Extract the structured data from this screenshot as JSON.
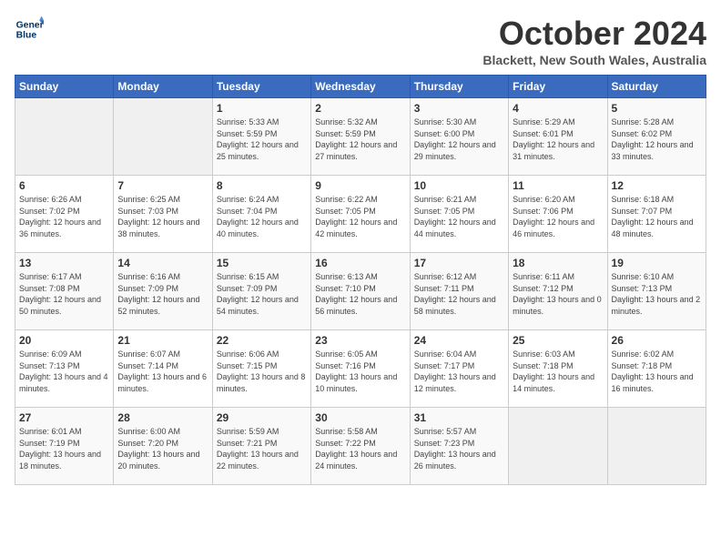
{
  "logo": {
    "line1": "General",
    "line2": "Blue"
  },
  "header": {
    "month": "October 2024",
    "location": "Blackett, New South Wales, Australia"
  },
  "weekdays": [
    "Sunday",
    "Monday",
    "Tuesday",
    "Wednesday",
    "Thursday",
    "Friday",
    "Saturday"
  ],
  "weeks": [
    [
      {
        "day": "",
        "empty": true
      },
      {
        "day": "",
        "empty": true
      },
      {
        "day": "1",
        "sunrise": "Sunrise: 5:33 AM",
        "sunset": "Sunset: 5:59 PM",
        "daylight": "Daylight: 12 hours and 25 minutes."
      },
      {
        "day": "2",
        "sunrise": "Sunrise: 5:32 AM",
        "sunset": "Sunset: 5:59 PM",
        "daylight": "Daylight: 12 hours and 27 minutes."
      },
      {
        "day": "3",
        "sunrise": "Sunrise: 5:30 AM",
        "sunset": "Sunset: 6:00 PM",
        "daylight": "Daylight: 12 hours and 29 minutes."
      },
      {
        "day": "4",
        "sunrise": "Sunrise: 5:29 AM",
        "sunset": "Sunset: 6:01 PM",
        "daylight": "Daylight: 12 hours and 31 minutes."
      },
      {
        "day": "5",
        "sunrise": "Sunrise: 5:28 AM",
        "sunset": "Sunset: 6:02 PM",
        "daylight": "Daylight: 12 hours and 33 minutes."
      }
    ],
    [
      {
        "day": "6",
        "sunrise": "Sunrise: 6:26 AM",
        "sunset": "Sunset: 7:02 PM",
        "daylight": "Daylight: 12 hours and 36 minutes."
      },
      {
        "day": "7",
        "sunrise": "Sunrise: 6:25 AM",
        "sunset": "Sunset: 7:03 PM",
        "daylight": "Daylight: 12 hours and 38 minutes."
      },
      {
        "day": "8",
        "sunrise": "Sunrise: 6:24 AM",
        "sunset": "Sunset: 7:04 PM",
        "daylight": "Daylight: 12 hours and 40 minutes."
      },
      {
        "day": "9",
        "sunrise": "Sunrise: 6:22 AM",
        "sunset": "Sunset: 7:05 PM",
        "daylight": "Daylight: 12 hours and 42 minutes."
      },
      {
        "day": "10",
        "sunrise": "Sunrise: 6:21 AM",
        "sunset": "Sunset: 7:05 PM",
        "daylight": "Daylight: 12 hours and 44 minutes."
      },
      {
        "day": "11",
        "sunrise": "Sunrise: 6:20 AM",
        "sunset": "Sunset: 7:06 PM",
        "daylight": "Daylight: 12 hours and 46 minutes."
      },
      {
        "day": "12",
        "sunrise": "Sunrise: 6:18 AM",
        "sunset": "Sunset: 7:07 PM",
        "daylight": "Daylight: 12 hours and 48 minutes."
      }
    ],
    [
      {
        "day": "13",
        "sunrise": "Sunrise: 6:17 AM",
        "sunset": "Sunset: 7:08 PM",
        "daylight": "Daylight: 12 hours and 50 minutes."
      },
      {
        "day": "14",
        "sunrise": "Sunrise: 6:16 AM",
        "sunset": "Sunset: 7:09 PM",
        "daylight": "Daylight: 12 hours and 52 minutes."
      },
      {
        "day": "15",
        "sunrise": "Sunrise: 6:15 AM",
        "sunset": "Sunset: 7:09 PM",
        "daylight": "Daylight: 12 hours and 54 minutes."
      },
      {
        "day": "16",
        "sunrise": "Sunrise: 6:13 AM",
        "sunset": "Sunset: 7:10 PM",
        "daylight": "Daylight: 12 hours and 56 minutes."
      },
      {
        "day": "17",
        "sunrise": "Sunrise: 6:12 AM",
        "sunset": "Sunset: 7:11 PM",
        "daylight": "Daylight: 12 hours and 58 minutes."
      },
      {
        "day": "18",
        "sunrise": "Sunrise: 6:11 AM",
        "sunset": "Sunset: 7:12 PM",
        "daylight": "Daylight: 13 hours and 0 minutes."
      },
      {
        "day": "19",
        "sunrise": "Sunrise: 6:10 AM",
        "sunset": "Sunset: 7:13 PM",
        "daylight": "Daylight: 13 hours and 2 minutes."
      }
    ],
    [
      {
        "day": "20",
        "sunrise": "Sunrise: 6:09 AM",
        "sunset": "Sunset: 7:13 PM",
        "daylight": "Daylight: 13 hours and 4 minutes."
      },
      {
        "day": "21",
        "sunrise": "Sunrise: 6:07 AM",
        "sunset": "Sunset: 7:14 PM",
        "daylight": "Daylight: 13 hours and 6 minutes."
      },
      {
        "day": "22",
        "sunrise": "Sunrise: 6:06 AM",
        "sunset": "Sunset: 7:15 PM",
        "daylight": "Daylight: 13 hours and 8 minutes."
      },
      {
        "day": "23",
        "sunrise": "Sunrise: 6:05 AM",
        "sunset": "Sunset: 7:16 PM",
        "daylight": "Daylight: 13 hours and 10 minutes."
      },
      {
        "day": "24",
        "sunrise": "Sunrise: 6:04 AM",
        "sunset": "Sunset: 7:17 PM",
        "daylight": "Daylight: 13 hours and 12 minutes."
      },
      {
        "day": "25",
        "sunrise": "Sunrise: 6:03 AM",
        "sunset": "Sunset: 7:18 PM",
        "daylight": "Daylight: 13 hours and 14 minutes."
      },
      {
        "day": "26",
        "sunrise": "Sunrise: 6:02 AM",
        "sunset": "Sunset: 7:18 PM",
        "daylight": "Daylight: 13 hours and 16 minutes."
      }
    ],
    [
      {
        "day": "27",
        "sunrise": "Sunrise: 6:01 AM",
        "sunset": "Sunset: 7:19 PM",
        "daylight": "Daylight: 13 hours and 18 minutes."
      },
      {
        "day": "28",
        "sunrise": "Sunrise: 6:00 AM",
        "sunset": "Sunset: 7:20 PM",
        "daylight": "Daylight: 13 hours and 20 minutes."
      },
      {
        "day": "29",
        "sunrise": "Sunrise: 5:59 AM",
        "sunset": "Sunset: 7:21 PM",
        "daylight": "Daylight: 13 hours and 22 minutes."
      },
      {
        "day": "30",
        "sunrise": "Sunrise: 5:58 AM",
        "sunset": "Sunset: 7:22 PM",
        "daylight": "Daylight: 13 hours and 24 minutes."
      },
      {
        "day": "31",
        "sunrise": "Sunrise: 5:57 AM",
        "sunset": "Sunset: 7:23 PM",
        "daylight": "Daylight: 13 hours and 26 minutes."
      },
      {
        "day": "",
        "empty": true
      },
      {
        "day": "",
        "empty": true
      }
    ]
  ]
}
